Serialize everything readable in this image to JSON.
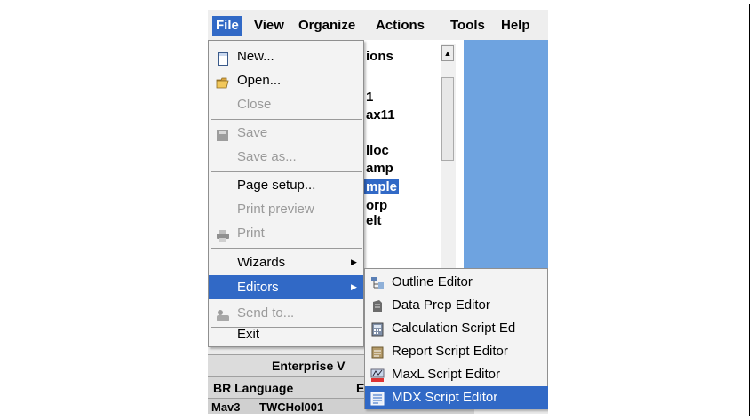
{
  "menubar": {
    "file": "File",
    "view": "View",
    "organize": "Organize",
    "actions": "Actions",
    "tools": "Tools",
    "help": "Help"
  },
  "background": {
    "list_items": [
      "ions",
      "1",
      "ax11",
      "lloc",
      "amp",
      "mple",
      "orp",
      "elt"
    ],
    "tab_row1": "Enterprise V",
    "tab_row2_a": "BR Language",
    "tab_row2_b": "E",
    "tab_row3_a": "Mav3",
    "tab_row3_b": "TWCHol001"
  },
  "file_menu": {
    "new": "New...",
    "open": "Open...",
    "close": "Close",
    "save": "Save",
    "save_as": "Save as...",
    "page_setup": "Page setup...",
    "print_preview": "Print preview",
    "print": "Print",
    "wizards": "Wizards",
    "editors": "Editors",
    "send_to": "Send to...",
    "exit": "Exit"
  },
  "editors_menu": {
    "outline": "Outline Editor",
    "data_prep": "Data Prep Editor",
    "calc_script": "Calculation Script Ed",
    "report_script": "Report Script Editor",
    "maxl_script": "MaxL Script Editor",
    "mdx_script": "MDX Script Editor"
  },
  "colors": {
    "highlight": "#3169c6",
    "desktop_blue": "#6ea3e0"
  }
}
